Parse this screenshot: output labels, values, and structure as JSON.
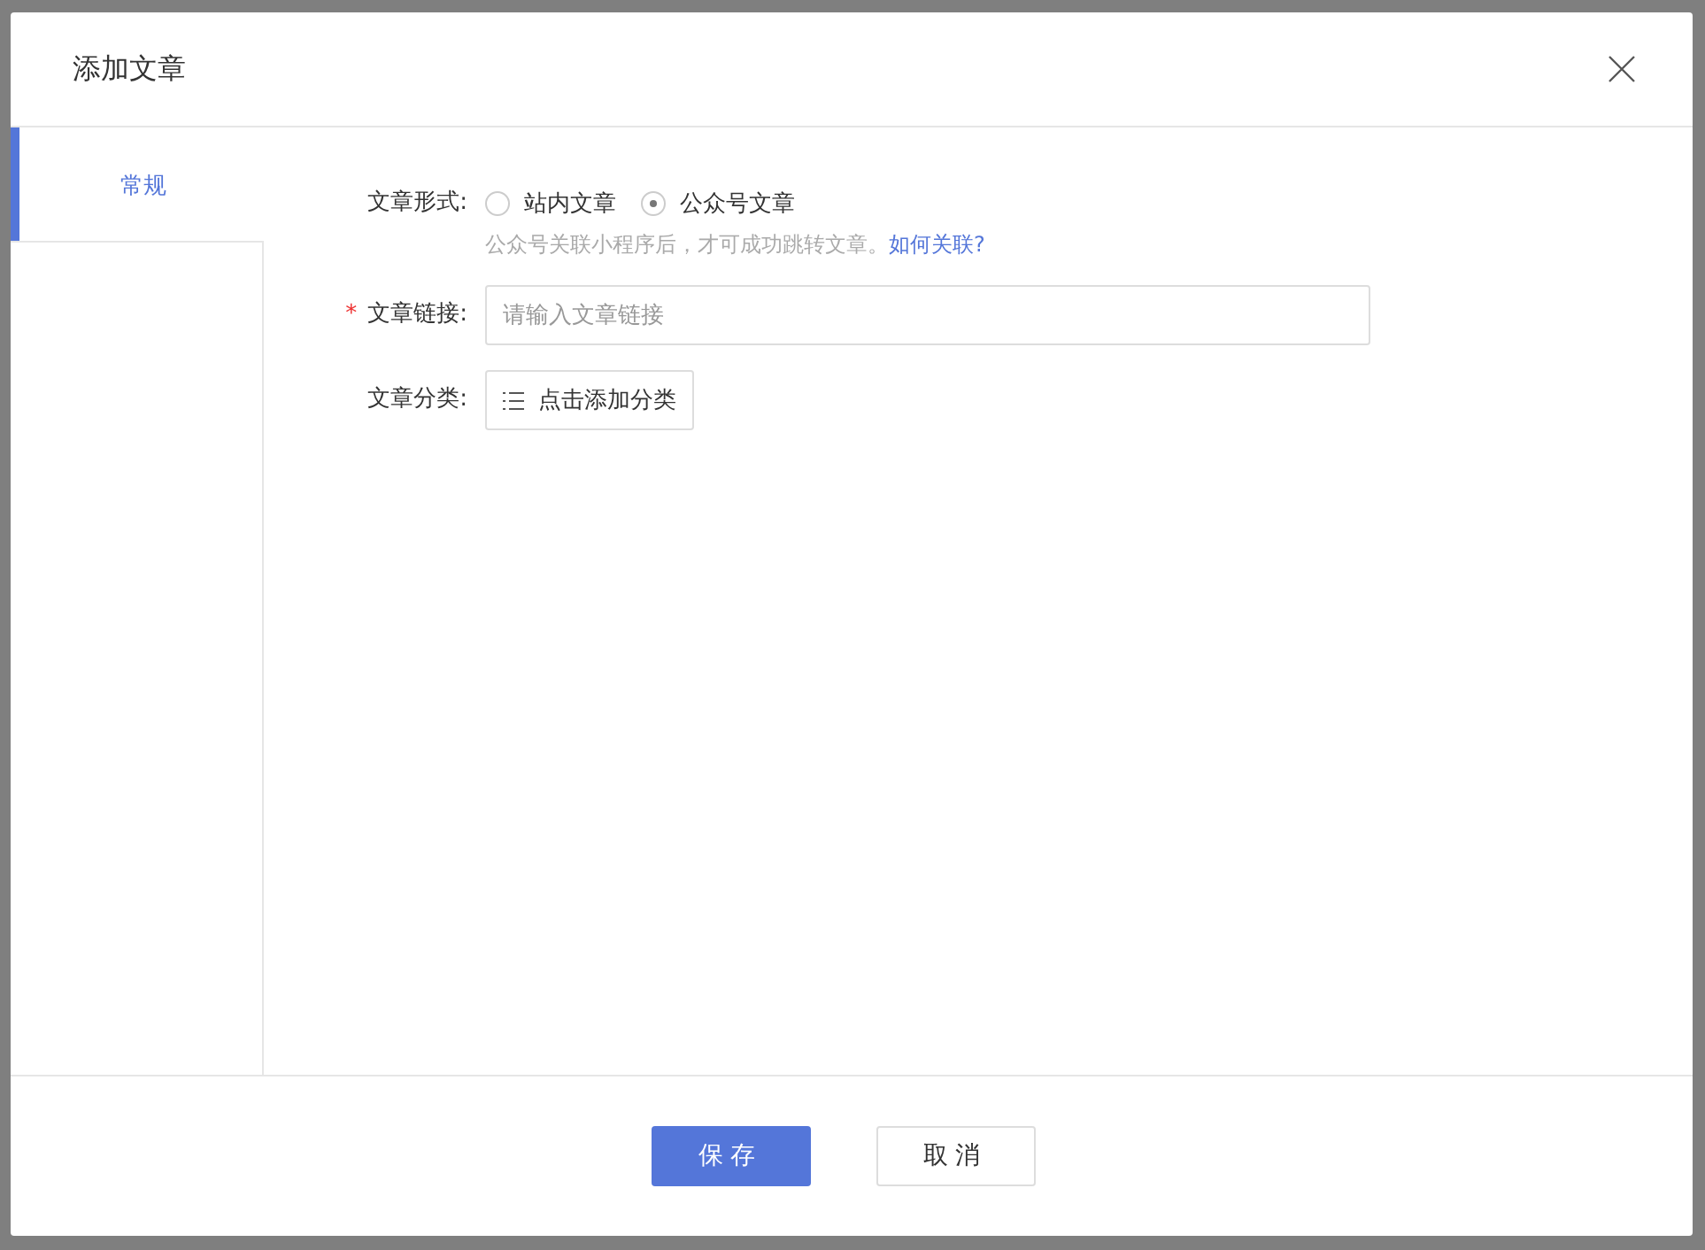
{
  "dialog": {
    "title": "添加文章"
  },
  "tabs": [
    {
      "label": "常规",
      "selected": true
    }
  ],
  "form": {
    "fields": [
      {
        "kind": "radio",
        "label": "文章形式:",
        "options": [
          {
            "label": "站内文章",
            "selected": false
          },
          {
            "label": "公众号文章",
            "selected": true
          }
        ],
        "hint": "公众号关联小程序后，才可成功跳转文章。",
        "hint_link": "如何关联?"
      },
      {
        "kind": "input",
        "label": "文章链接:",
        "required_mark": "*",
        "placeholder": "请输入文章链接"
      },
      {
        "kind": "category",
        "label": "文章分类:",
        "button": "点击添加分类"
      }
    ]
  },
  "buttons": [
    {
      "label": "保存",
      "kind": "primary"
    },
    {
      "label": "取消",
      "kind": "default"
    }
  ]
}
